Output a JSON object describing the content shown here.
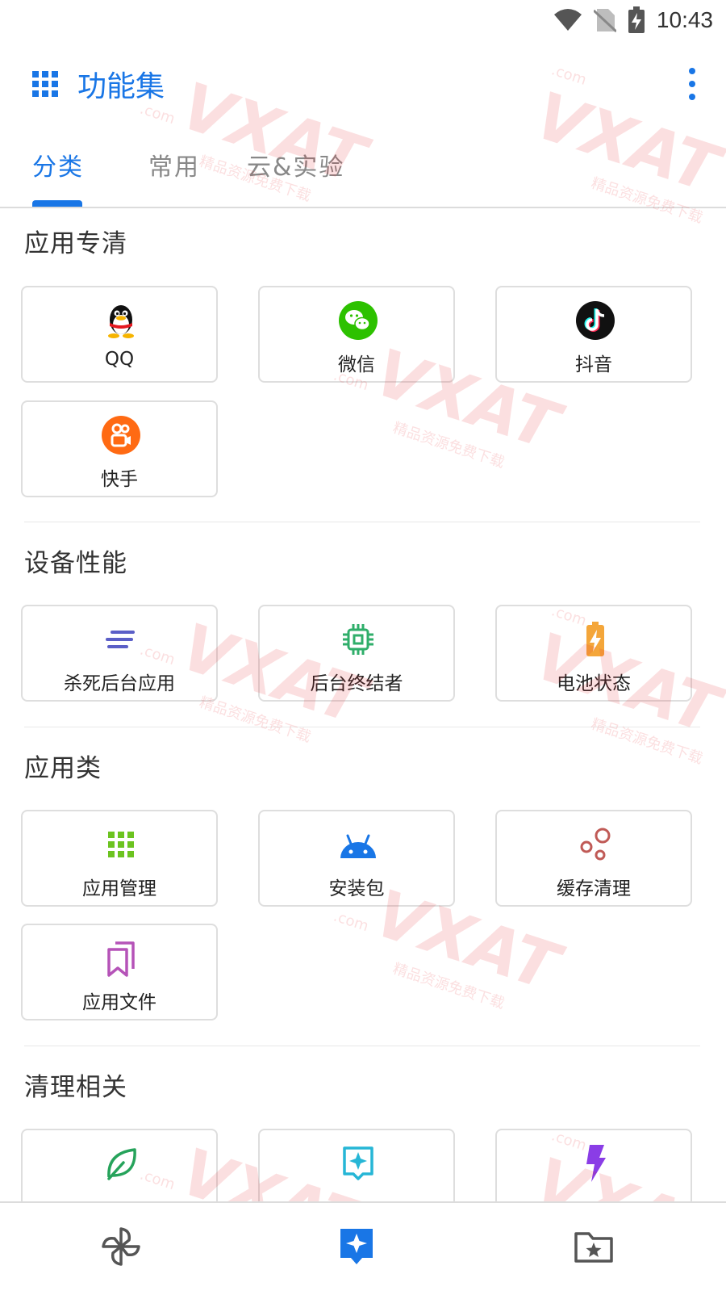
{
  "status_bar": {
    "time": "10:43"
  },
  "app_bar": {
    "title": "功能集"
  },
  "tabs": [
    {
      "label": "分类"
    },
    {
      "label": "常用"
    },
    {
      "label": "云&实验"
    }
  ],
  "sections": [
    {
      "title": "应用专清",
      "items": [
        {
          "label": "QQ",
          "icon": "qq-penguin-icon"
        },
        {
          "label": "微信",
          "icon": "wechat-icon"
        },
        {
          "label": "抖音",
          "icon": "tiktok-icon"
        },
        {
          "label": "快手",
          "icon": "kuaishou-icon"
        }
      ]
    },
    {
      "title": "设备性能",
      "items": [
        {
          "label": "杀死后台应用",
          "icon": "lines-icon"
        },
        {
          "label": "后台终结者",
          "icon": "chip-icon"
        },
        {
          "label": "电池状态",
          "icon": "battery-icon"
        }
      ]
    },
    {
      "title": "应用类",
      "items": [
        {
          "label": "应用管理",
          "icon": "app-grid-icon"
        },
        {
          "label": "安装包",
          "icon": "android-icon"
        },
        {
          "label": "缓存清理",
          "icon": "bubbles-icon"
        },
        {
          "label": "应用文件",
          "icon": "bookmark-icon"
        }
      ]
    },
    {
      "title": "清理相关",
      "items": [
        {
          "label": "",
          "icon": "leaf-icon"
        },
        {
          "label": "",
          "icon": "sparkle-box-icon"
        },
        {
          "label": "",
          "icon": "lightning-icon"
        }
      ]
    }
  ],
  "watermark": {
    "brand": "VXAT",
    "domain": ".com",
    "tagline": "精品资源免费下载"
  },
  "colors": {
    "accent": "#1976e6",
    "wechat": "#2dc100",
    "kuaishou": "#ff6a13",
    "tiktok": "#111111",
    "lines": "#5b5fc7",
    "chip": "#2fae6a",
    "battery": "#f4a63a",
    "app_grid": "#6cc320",
    "android": "#1976e6",
    "bubbles": "#c05a56",
    "bookmark": "#b553b8",
    "leaf": "#26a35b",
    "sparkle": "#26b6d6",
    "lightning": "#8a3de6"
  }
}
